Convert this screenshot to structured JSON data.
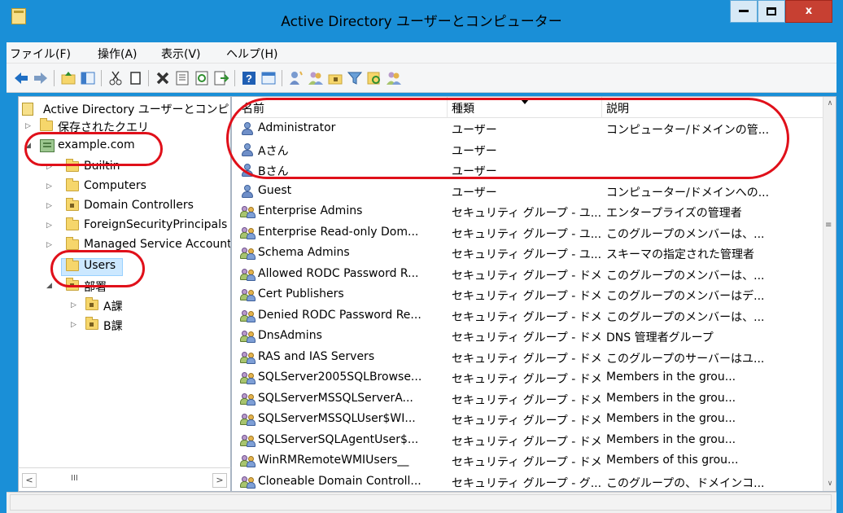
{
  "window": {
    "title": "Active Directory ユーザーとコンピューター"
  },
  "menu": [
    "ファイル(F)",
    "操作(A)",
    "表示(V)",
    "ヘルプ(H)"
  ],
  "toolbar_icons": [
    "back-arrow-icon",
    "forward-arrow-icon",
    "up-folder-icon",
    "show-tree-icon",
    "cut-icon",
    "copy-icon",
    "delete-icon",
    "properties-icon",
    "refresh-icon",
    "export-icon",
    "help-icon",
    "console-tree-icon",
    "new-user-icon",
    "new-group-icon",
    "new-ou-icon",
    "filter-icon",
    "find-icon",
    "add-to-group-icon"
  ],
  "tree": {
    "root": "Active Directory ユーザーとコンピューター",
    "saved_queries": "保存されたクエリ",
    "domain": "example.com",
    "builtin": "Builtin",
    "computers": "Computers",
    "domain_controllers": "Domain Controllers",
    "foreign": "ForeignSecurityPrincipals",
    "msa": "Managed Service Accounts",
    "users": "Users",
    "dept": "部署",
    "a_ka": "A課",
    "b_ka": "B課"
  },
  "columns": {
    "name": "名前",
    "type": "種類",
    "desc": "説明"
  },
  "rows": [
    {
      "icon": "user",
      "name": "Administrator",
      "type": "ユーザー",
      "desc": "コンピューター/ドメインの管..."
    },
    {
      "icon": "user",
      "name": "Aさん",
      "type": "ユーザー",
      "desc": ""
    },
    {
      "icon": "user",
      "name": "Bさん",
      "type": "ユーザー",
      "desc": ""
    },
    {
      "icon": "user",
      "name": "Guest",
      "type": "ユーザー",
      "desc": "コンピューター/ドメインへの..."
    },
    {
      "icon": "group",
      "name": "Enterprise Admins",
      "type": "セキュリティ グループ - ユ...",
      "desc": "エンタープライズの管理者"
    },
    {
      "icon": "group",
      "name": "Enterprise Read-only Dom...",
      "type": "セキュリティ グループ - ユ...",
      "desc": "このグループのメンバーは、..."
    },
    {
      "icon": "group",
      "name": "Schema Admins",
      "type": "セキュリティ グループ - ユ...",
      "desc": "スキーマの指定された管理者"
    },
    {
      "icon": "group",
      "name": "Allowed RODC Password R...",
      "type": "セキュリティ グループ - ドメ...",
      "desc": "このグループのメンバーは、..."
    },
    {
      "icon": "group",
      "name": "Cert Publishers",
      "type": "セキュリティ グループ - ドメ...",
      "desc": "このグループのメンバーはデ..."
    },
    {
      "icon": "group",
      "name": "Denied RODC Password Re...",
      "type": "セキュリティ グループ - ドメ...",
      "desc": "このグループのメンバーは、..."
    },
    {
      "icon": "group",
      "name": "DnsAdmins",
      "type": "セキュリティ グループ - ドメ...",
      "desc": "DNS 管理者グループ"
    },
    {
      "icon": "group",
      "name": "RAS and IAS Servers",
      "type": "セキュリティ グループ - ドメ...",
      "desc": "このグループのサーバーはユ..."
    },
    {
      "icon": "group",
      "name": "SQLServer2005SQLBrowse...",
      "type": "セキュリティ グループ - ドメ...",
      "desc": "Members in the grou..."
    },
    {
      "icon": "group",
      "name": "SQLServerMSSQLServerA...",
      "type": "セキュリティ グループ - ドメ...",
      "desc": "Members in the grou..."
    },
    {
      "icon": "group",
      "name": "SQLServerMSSQLUser$WI...",
      "type": "セキュリティ グループ - ドメ...",
      "desc": "Members in the grou..."
    },
    {
      "icon": "group",
      "name": "SQLServerSQLAgentUser$...",
      "type": "セキュリティ グループ - ドメ...",
      "desc": "Members in the grou..."
    },
    {
      "icon": "group",
      "name": "WinRMRemoteWMIUsers__",
      "type": "セキュリティ グループ - ドメ...",
      "desc": "Members of this grou..."
    },
    {
      "icon": "group",
      "name": "Cloneable Domain Controll...",
      "type": "セキュリティ グループ - グ...",
      "desc": "このグループの、ドメインコ..."
    }
  ],
  "colors": {
    "titlebar": "#1a8fd7",
    "highlight": "#e0101a",
    "selection": "#cce8ff"
  }
}
